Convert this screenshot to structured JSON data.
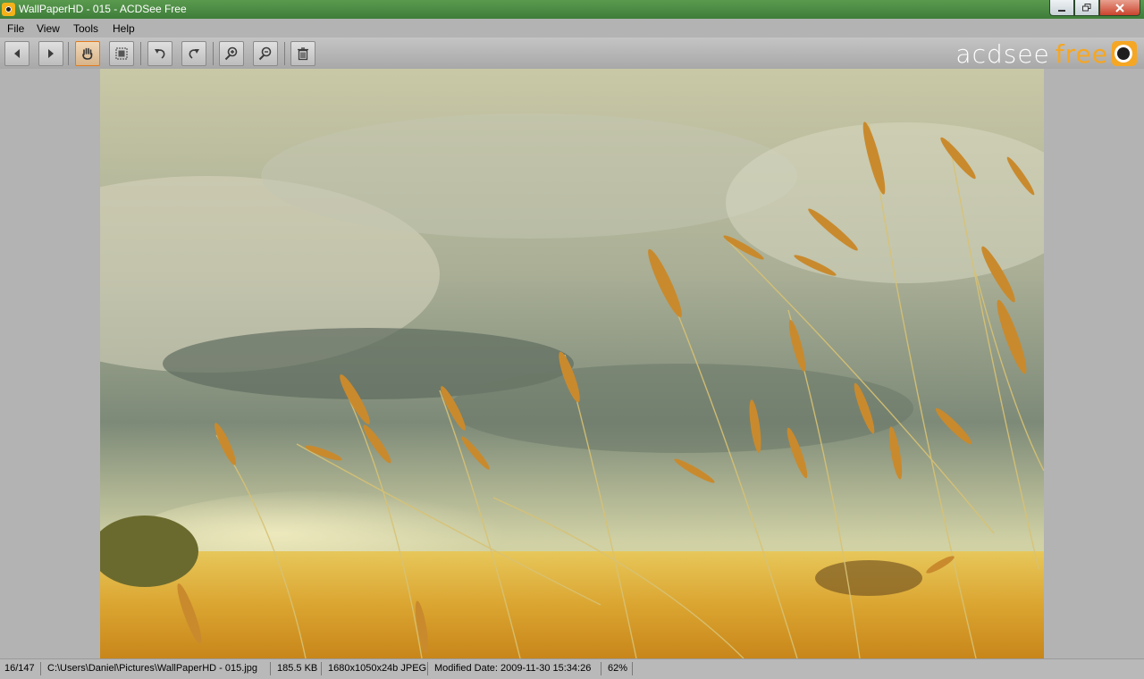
{
  "window": {
    "title": "WallPaperHD - 015 - ACDSee Free",
    "controls": [
      "minimize-icon",
      "restore-icon",
      "close-icon"
    ]
  },
  "menu": [
    "File",
    "View",
    "Tools",
    "Help"
  ],
  "toolbar": {
    "buttons": [
      {
        "name": "previous",
        "icon": "arrow-left-icon"
      },
      {
        "name": "next",
        "icon": "arrow-right-icon"
      },
      {
        "name": "pan-hand",
        "icon": "hand-icon",
        "active": true
      },
      {
        "name": "select",
        "icon": "select-icon"
      },
      {
        "name": "rotate-left",
        "icon": "rotate-left-icon"
      },
      {
        "name": "rotate-right",
        "icon": "rotate-right-icon"
      },
      {
        "name": "zoom-in",
        "icon": "zoom-in-icon"
      },
      {
        "name": "zoom-out",
        "icon": "zoom-out-icon"
      },
      {
        "name": "delete",
        "icon": "trash-icon"
      }
    ]
  },
  "logo": {
    "text_main": "acdsee",
    "text_accent": "free",
    "accent_color": "#f5a623"
  },
  "image": {
    "subject": "wheat grass field under cloudy sky"
  },
  "status": {
    "position": "16/147",
    "path": "C:\\Users\\Daniel\\Pictures\\WallPaperHD - 015.jpg",
    "size": "185.5 KB",
    "dimensions": "1680x1050x24b JPEG",
    "modified": "Modified Date: 2009-11-30 15:34:26",
    "zoom": "62%"
  },
  "colors": {
    "titlebar": "#4a8a44",
    "chrome": "#b3b3b3",
    "active_tool": "#e07a1f"
  }
}
